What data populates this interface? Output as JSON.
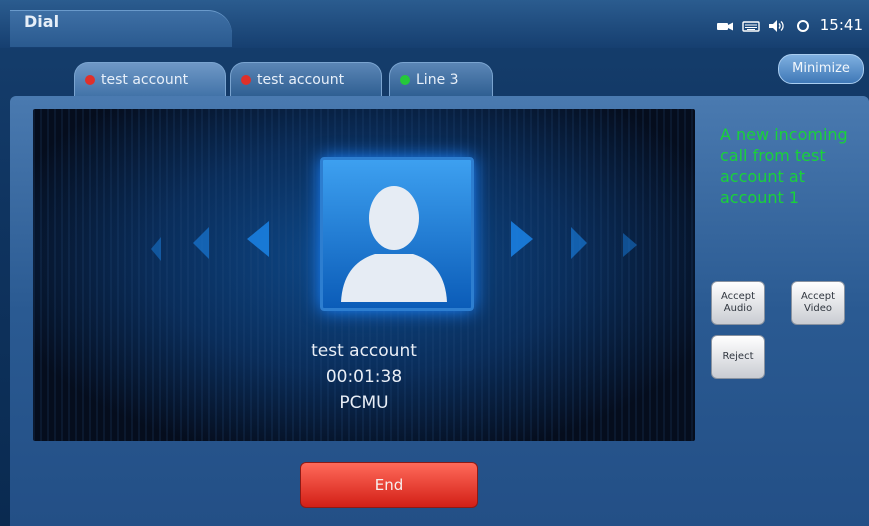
{
  "header": {
    "title": "Dial",
    "clock": "15:41",
    "status_icons": [
      "camera-icon",
      "keyboard-icon",
      "speaker-icon",
      "sync-icon"
    ]
  },
  "tabs": [
    {
      "label": "test account",
      "status_color": "#e0302a",
      "active": true
    },
    {
      "label": "test account",
      "status_color": "#e0302a",
      "active": false
    },
    {
      "label": "Line 3",
      "status_color": "#25c93a",
      "active": false
    }
  ],
  "minimize_label": "Minimize",
  "call": {
    "name": "test account",
    "duration": "00:01:38",
    "codec": "PCMU"
  },
  "notification": "A new incoming call from test account at account 1",
  "actions": {
    "accept_audio": "Accept Audio",
    "accept_video": "Accept Video",
    "reject": "Reject",
    "end": "End"
  },
  "colors": {
    "notification_text": "#19d23a",
    "end_button": "#d31f16",
    "accent_blue": "#1b84ff"
  }
}
